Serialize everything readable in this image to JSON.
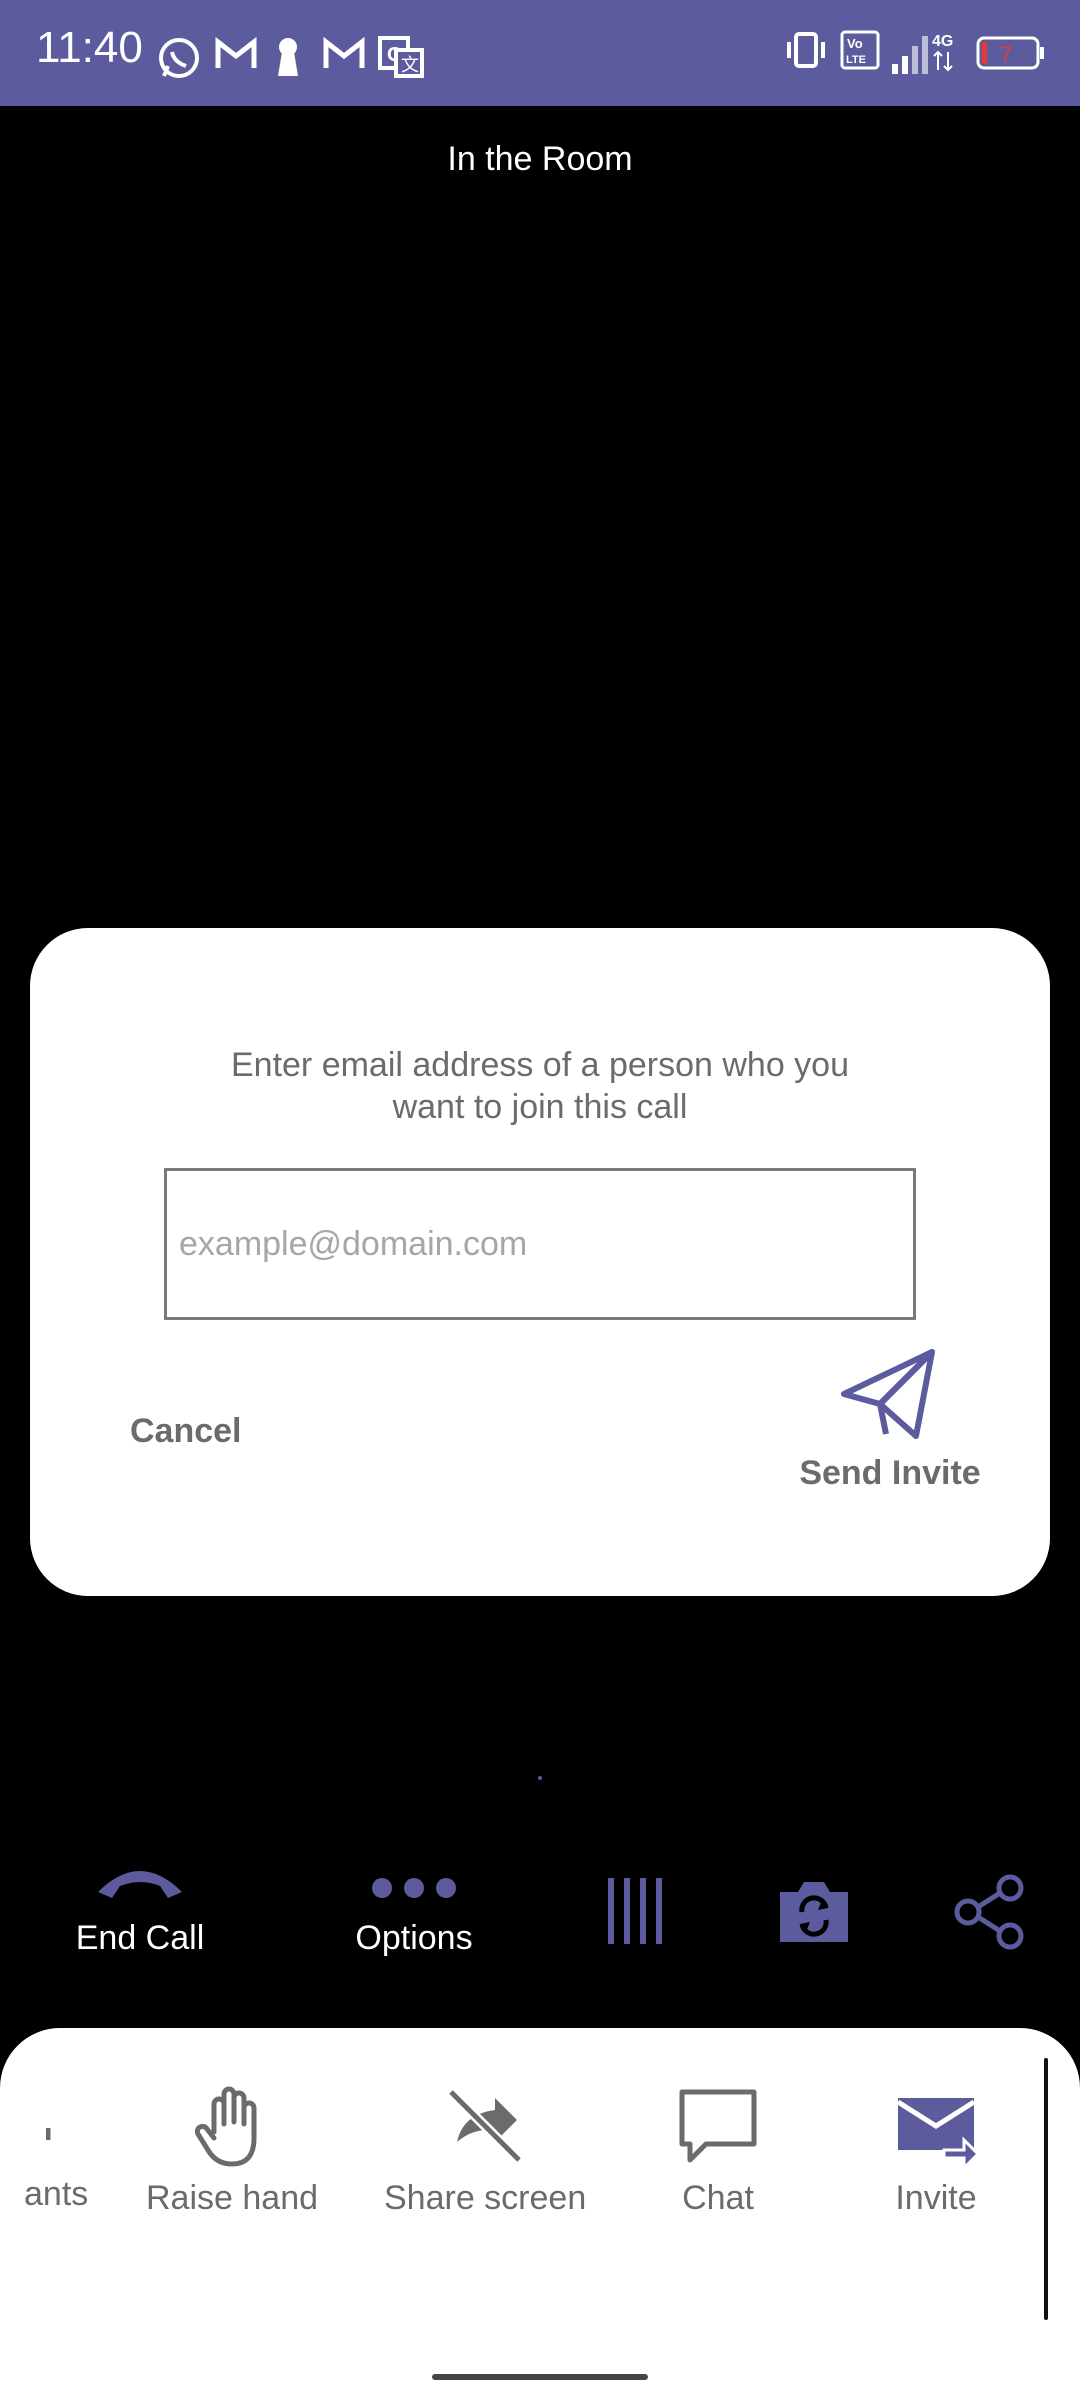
{
  "status_bar": {
    "time": "11:40",
    "battery_level": "7",
    "network": "4G",
    "left_icons": [
      "whatsapp-icon",
      "gmail-icon",
      "keyhole-icon",
      "gmail-icon",
      "translate-icon"
    ],
    "right_icons": [
      "vibrate-icon",
      "volte-icon",
      "signal-icon",
      "battery-icon"
    ]
  },
  "header": {
    "title": "In the Room"
  },
  "dialog": {
    "message": "Enter email address of a person who you want to join this call",
    "email_placeholder": "example@domain.com",
    "email_value": "",
    "cancel_label": "Cancel",
    "send_label": "Send Invite",
    "send_icon": "paper-plane-icon"
  },
  "controls": {
    "end_call_label": "End Call",
    "options_label": "Options",
    "icons": [
      "phone-hangup-icon",
      "more-dots-icon",
      "layout-columns-icon",
      "switch-camera-icon",
      "share-icon"
    ]
  },
  "bottom_sheet": {
    "items": [
      {
        "label": "ants",
        "icon": "participants-icon"
      },
      {
        "label": "Raise hand",
        "icon": "hand-icon"
      },
      {
        "label": "Share screen",
        "icon": "share-screen-off-icon"
      },
      {
        "label": "Chat",
        "icon": "chat-bubble-icon"
      },
      {
        "label": "Invite",
        "icon": "invite-mail-icon"
      }
    ]
  },
  "colors": {
    "accent": "#5b5b9e",
    "background": "#000000",
    "dialog_bg": "#ffffff",
    "muted_text": "#6b6b6b"
  }
}
